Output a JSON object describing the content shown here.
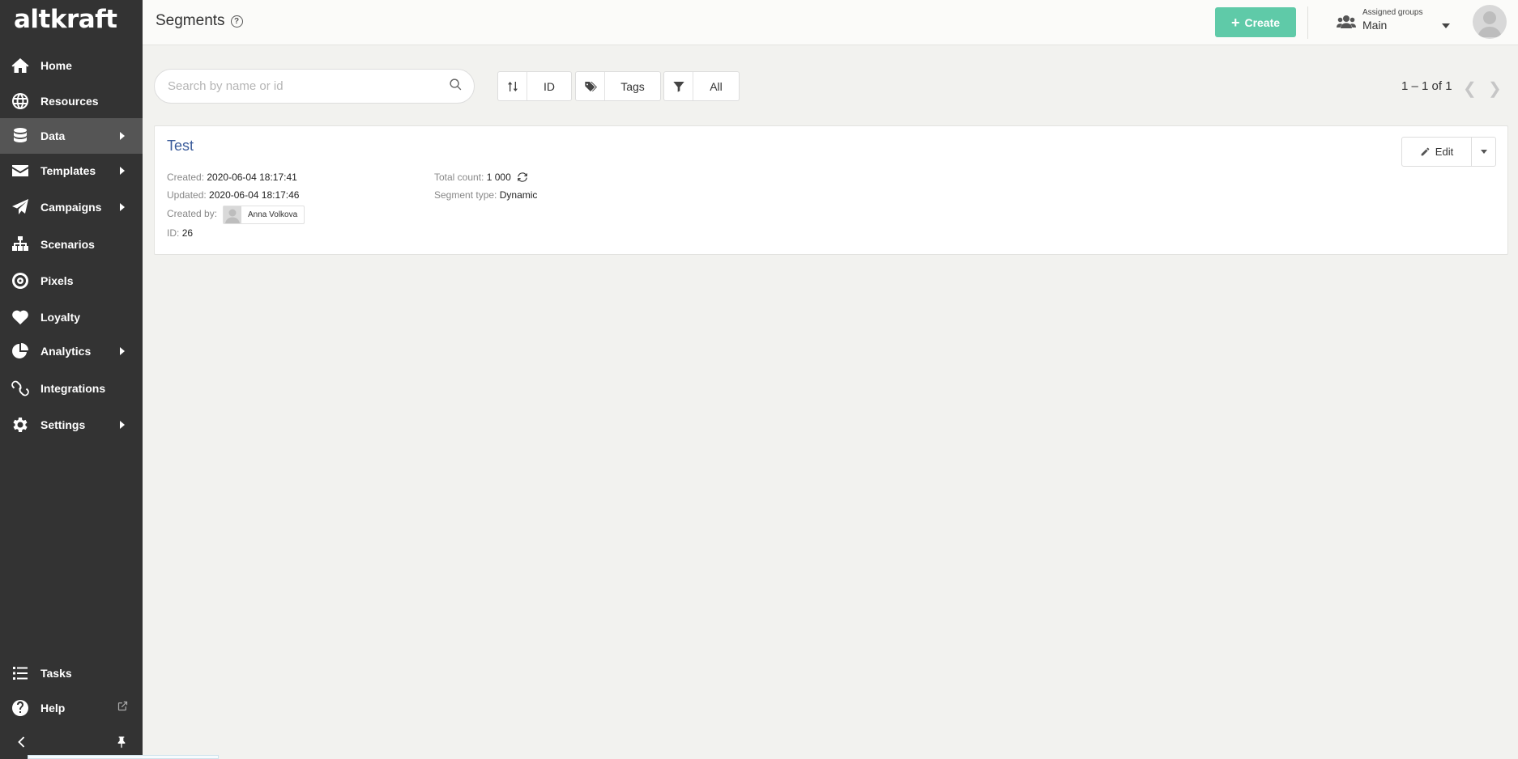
{
  "app": {
    "logo": "altkraft"
  },
  "sidebar": {
    "items": [
      {
        "label": "Home",
        "icon": "home-icon",
        "has_submenu": false
      },
      {
        "label": "Resources",
        "icon": "globe-icon",
        "has_submenu": false
      },
      {
        "label": "Data",
        "icon": "database-icon",
        "has_submenu": true,
        "active": true
      },
      {
        "label": "Templates",
        "icon": "envelope-icon",
        "has_submenu": true
      },
      {
        "label": "Campaigns",
        "icon": "paper-plane-icon",
        "has_submenu": true
      },
      {
        "label": "Scenarios",
        "icon": "sitemap-icon",
        "has_submenu": false
      },
      {
        "label": "Pixels",
        "icon": "target-icon",
        "has_submenu": false
      },
      {
        "label": "Loyalty",
        "icon": "heart-icon",
        "has_submenu": false
      },
      {
        "label": "Analytics",
        "icon": "pie-chart-icon",
        "has_submenu": true
      },
      {
        "label": "Integrations",
        "icon": "link-icon",
        "has_submenu": false
      },
      {
        "label": "Settings",
        "icon": "gear-icon",
        "has_submenu": true
      }
    ],
    "bottom_items": [
      {
        "label": "Tasks",
        "icon": "list-icon"
      },
      {
        "label": "Help",
        "icon": "question-circle-icon",
        "external": true
      }
    ]
  },
  "header": {
    "title": "Segments",
    "help": "?",
    "create_label": "Create",
    "groups_caption": "Assigned groups",
    "groups_value": "Main"
  },
  "toolbar": {
    "search_placeholder": "Search by name or id",
    "search_value": "",
    "sort_label": "ID",
    "tags_label": "Tags",
    "filter_label": "All",
    "pagination": "1 – 1 of 1"
  },
  "segments": [
    {
      "name": "Test",
      "created_key": "Created:",
      "created": "2020-06-04 18:17:41",
      "updated_key": "Updated:",
      "updated": "2020-06-04 18:17:46",
      "created_by_key": "Created by:",
      "created_by": "Anna Volkova",
      "id_key": "ID:",
      "id": "26",
      "total_count_key": "Total count:",
      "total_count": "1 000",
      "segment_type_key": "Segment type:",
      "segment_type": "Dynamic",
      "edit_label": "Edit"
    }
  ],
  "colors": {
    "sidebar_bg": "#333333",
    "sidebar_active": "#555555",
    "accent_green": "#5fcaa8",
    "link_blue": "#3a5b9a",
    "page_bg": "#f2f2ef"
  }
}
